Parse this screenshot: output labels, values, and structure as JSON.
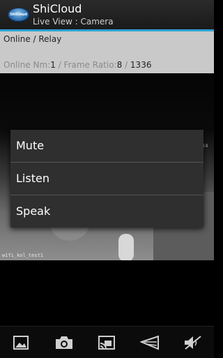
{
  "header": {
    "app_title": "ShiCloud",
    "subtitle": "Live View : Camera",
    "logo_text": "ShiCloud"
  },
  "info": {
    "status": "Online / Relay",
    "stats_prefix": "Online Nm:",
    "online_nm": "1",
    "frame_label": " / Frame Ratio:",
    "frame_ratio": "8",
    "frame_sep": " / ",
    "frame_count": "1336"
  },
  "video": {
    "camera_label": "wifi_kol_test1",
    "corner_text": "14"
  },
  "menu": {
    "items": [
      {
        "label": "Mute"
      },
      {
        "label": "Listen"
      },
      {
        "label": "Speak"
      }
    ]
  },
  "toolbar": {
    "icons": [
      "gallery-icon",
      "camera-icon",
      "cast-icon",
      "speaker-icon",
      "mute-icon"
    ]
  },
  "colors": {
    "accent": "#2aa3d2",
    "menu_bg": "#2f2f2f",
    "info_bg": "#c9c9c9"
  }
}
